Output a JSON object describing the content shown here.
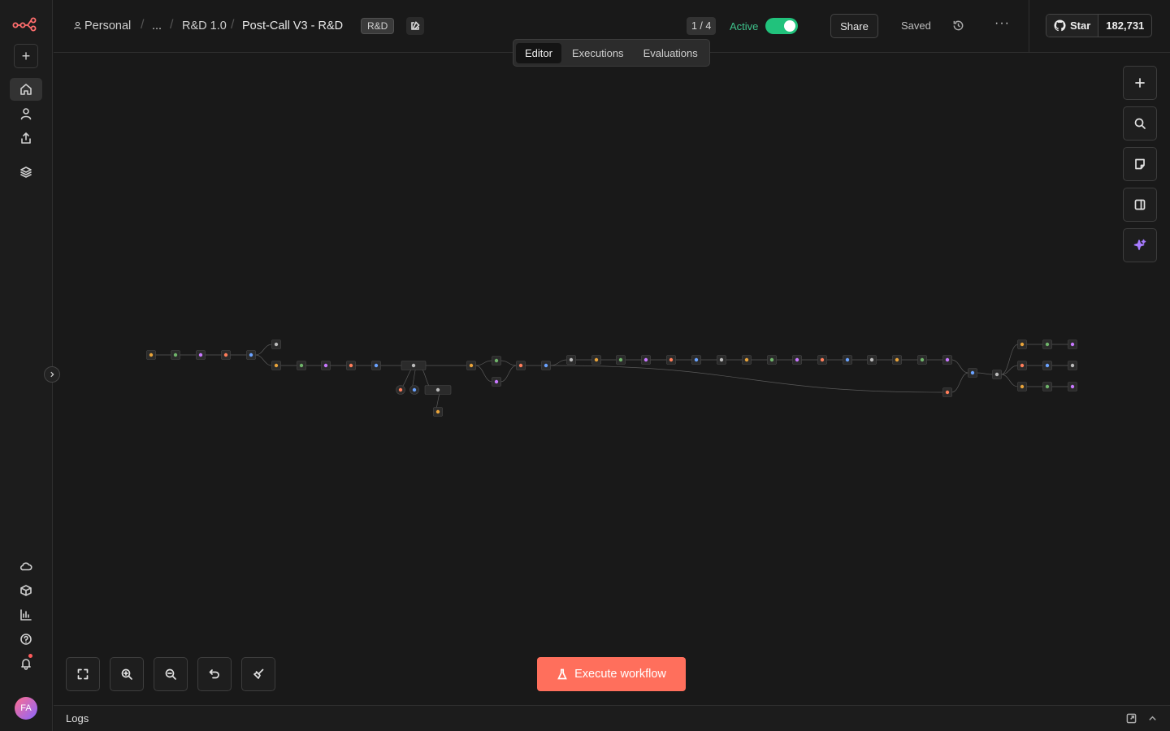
{
  "sidebar": {
    "logo": "n8n-logo-icon",
    "new_button": "+",
    "avatar_initials": "FA"
  },
  "breadcrumb": {
    "project": "Personal",
    "ellipsis": "...",
    "folder": "R&D 1.0",
    "workflow": "Post-Call V3 - R&D",
    "tag": "R&D"
  },
  "header": {
    "page_count": "1 / 4",
    "active_label": "Active",
    "active": true,
    "share_label": "Share",
    "saved_label": "Saved",
    "more_label": "···",
    "github_star_label": "Star",
    "github_star_count": "182,731"
  },
  "tabs": [
    {
      "label": "Editor",
      "selected": true
    },
    {
      "label": "Executions",
      "selected": false
    },
    {
      "label": "Evaluations",
      "selected": false
    }
  ],
  "canvas": {
    "execute_label": "Execute workflow"
  },
  "logs": {
    "label": "Logs"
  },
  "colors": {
    "accent": "#ff6f5c",
    "active_green": "#21c27c",
    "background": "#191919"
  }
}
